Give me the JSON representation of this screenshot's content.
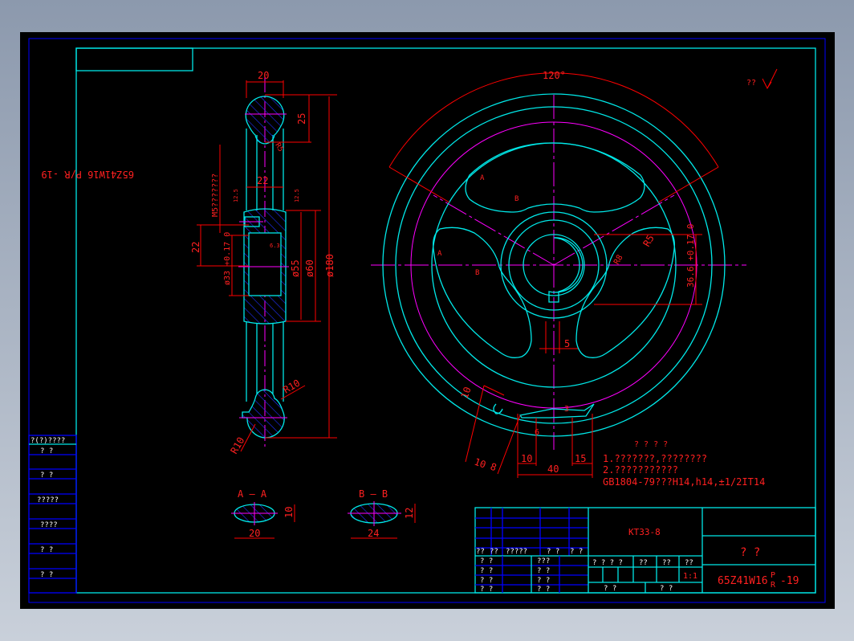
{
  "drawing": {
    "upside_title": "65Z41W16 P/R -19",
    "roughness_note": "?? ",
    "side_view": {
      "dim_width_top": "20",
      "dim_25": "25",
      "dim_r5": "R5",
      "dim_22_neck": "22",
      "rough_left": "12.5",
      "rough_right": "12.5",
      "note_m5": "M5???????",
      "dim_22_left": "22",
      "dim_bore": "ø33 +0.17 0",
      "rough_bore": "6.3",
      "dim_d55": "ø55",
      "dim_d60": "ø60",
      "dim_d180": "ø180",
      "dim_r10_a": "R10",
      "dim_r10_b": "R10"
    },
    "front_view": {
      "angle": "120°",
      "label_a1": "A",
      "label_a2": "A",
      "label_b1": "B",
      "label_b2": "B",
      "dim_r5": "R5",
      "dim_r8": "R8",
      "dim_keyway": "36.6 +0.17 0",
      "dim_5": "5",
      "dim_10a": "10",
      "dim_10b": "10",
      "dim_8": "8",
      "dim_6": "6",
      "dim_3": "3",
      "dim_10c": "10",
      "dim_15": "15",
      "dim_40": "40"
    },
    "sections": {
      "aa_label": "A — A",
      "aa_w": "20",
      "aa_h": "10",
      "bb_label": "B — B",
      "bb_w": "24",
      "bb_h": "12"
    },
    "notes": {
      "heading": "? ? ? ?",
      "line1": "1.???????,????????",
      "line2": "2.???????????",
      "line3": "GB1804-79???H14,h14,±1/2IT14"
    },
    "left_strip": [
      "?(?)????",
      "?    ?",
      "?    ?",
      "?????",
      "????",
      "?    ?",
      "?    ?"
    ],
    "title_block": {
      "grid_header": [
        "??",
        "??",
        "?????",
        "?  ?",
        "?  ?"
      ],
      "left_rows": [
        [
          "?  ?",
          "???"
        ],
        [
          "?  ?",
          "?  ?"
        ],
        [
          "?  ?",
          "?  ?"
        ],
        [
          "?  ?",
          "?  ?"
        ]
      ],
      "material": "KT33-8",
      "mid_headers": [
        "? ? ? ?",
        "??",
        "??",
        "??"
      ],
      "scale": "1:1",
      "mid_bottom": [
        "?     ?",
        "?     ?"
      ],
      "part_name": "?     ?",
      "drawing_no": "65Z41W16",
      "drawing_no_sup": "P",
      "drawing_no_sub": "R",
      "drawing_no_suffix": "-19"
    }
  }
}
